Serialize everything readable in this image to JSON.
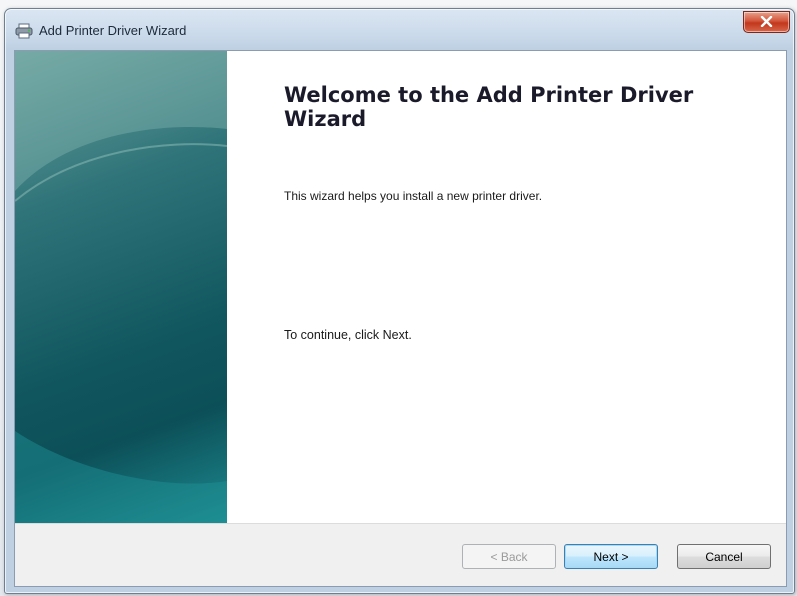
{
  "window": {
    "title": "Add Printer Driver Wizard",
    "icon": "printer-icon",
    "close_icon": "close-icon"
  },
  "wizard": {
    "heading": "Welcome to the Add Printer Driver Wizard",
    "description": "This wizard helps you install a new printer driver.",
    "continue_text": "To continue, click Next."
  },
  "buttons": {
    "back_label": "< Back",
    "next_label": "Next >",
    "cancel_label": "Cancel"
  },
  "colors": {
    "side_panel_dark": "#0c4f58",
    "side_panel_light": "#6fa4a0",
    "close_button": "#c2371c"
  }
}
